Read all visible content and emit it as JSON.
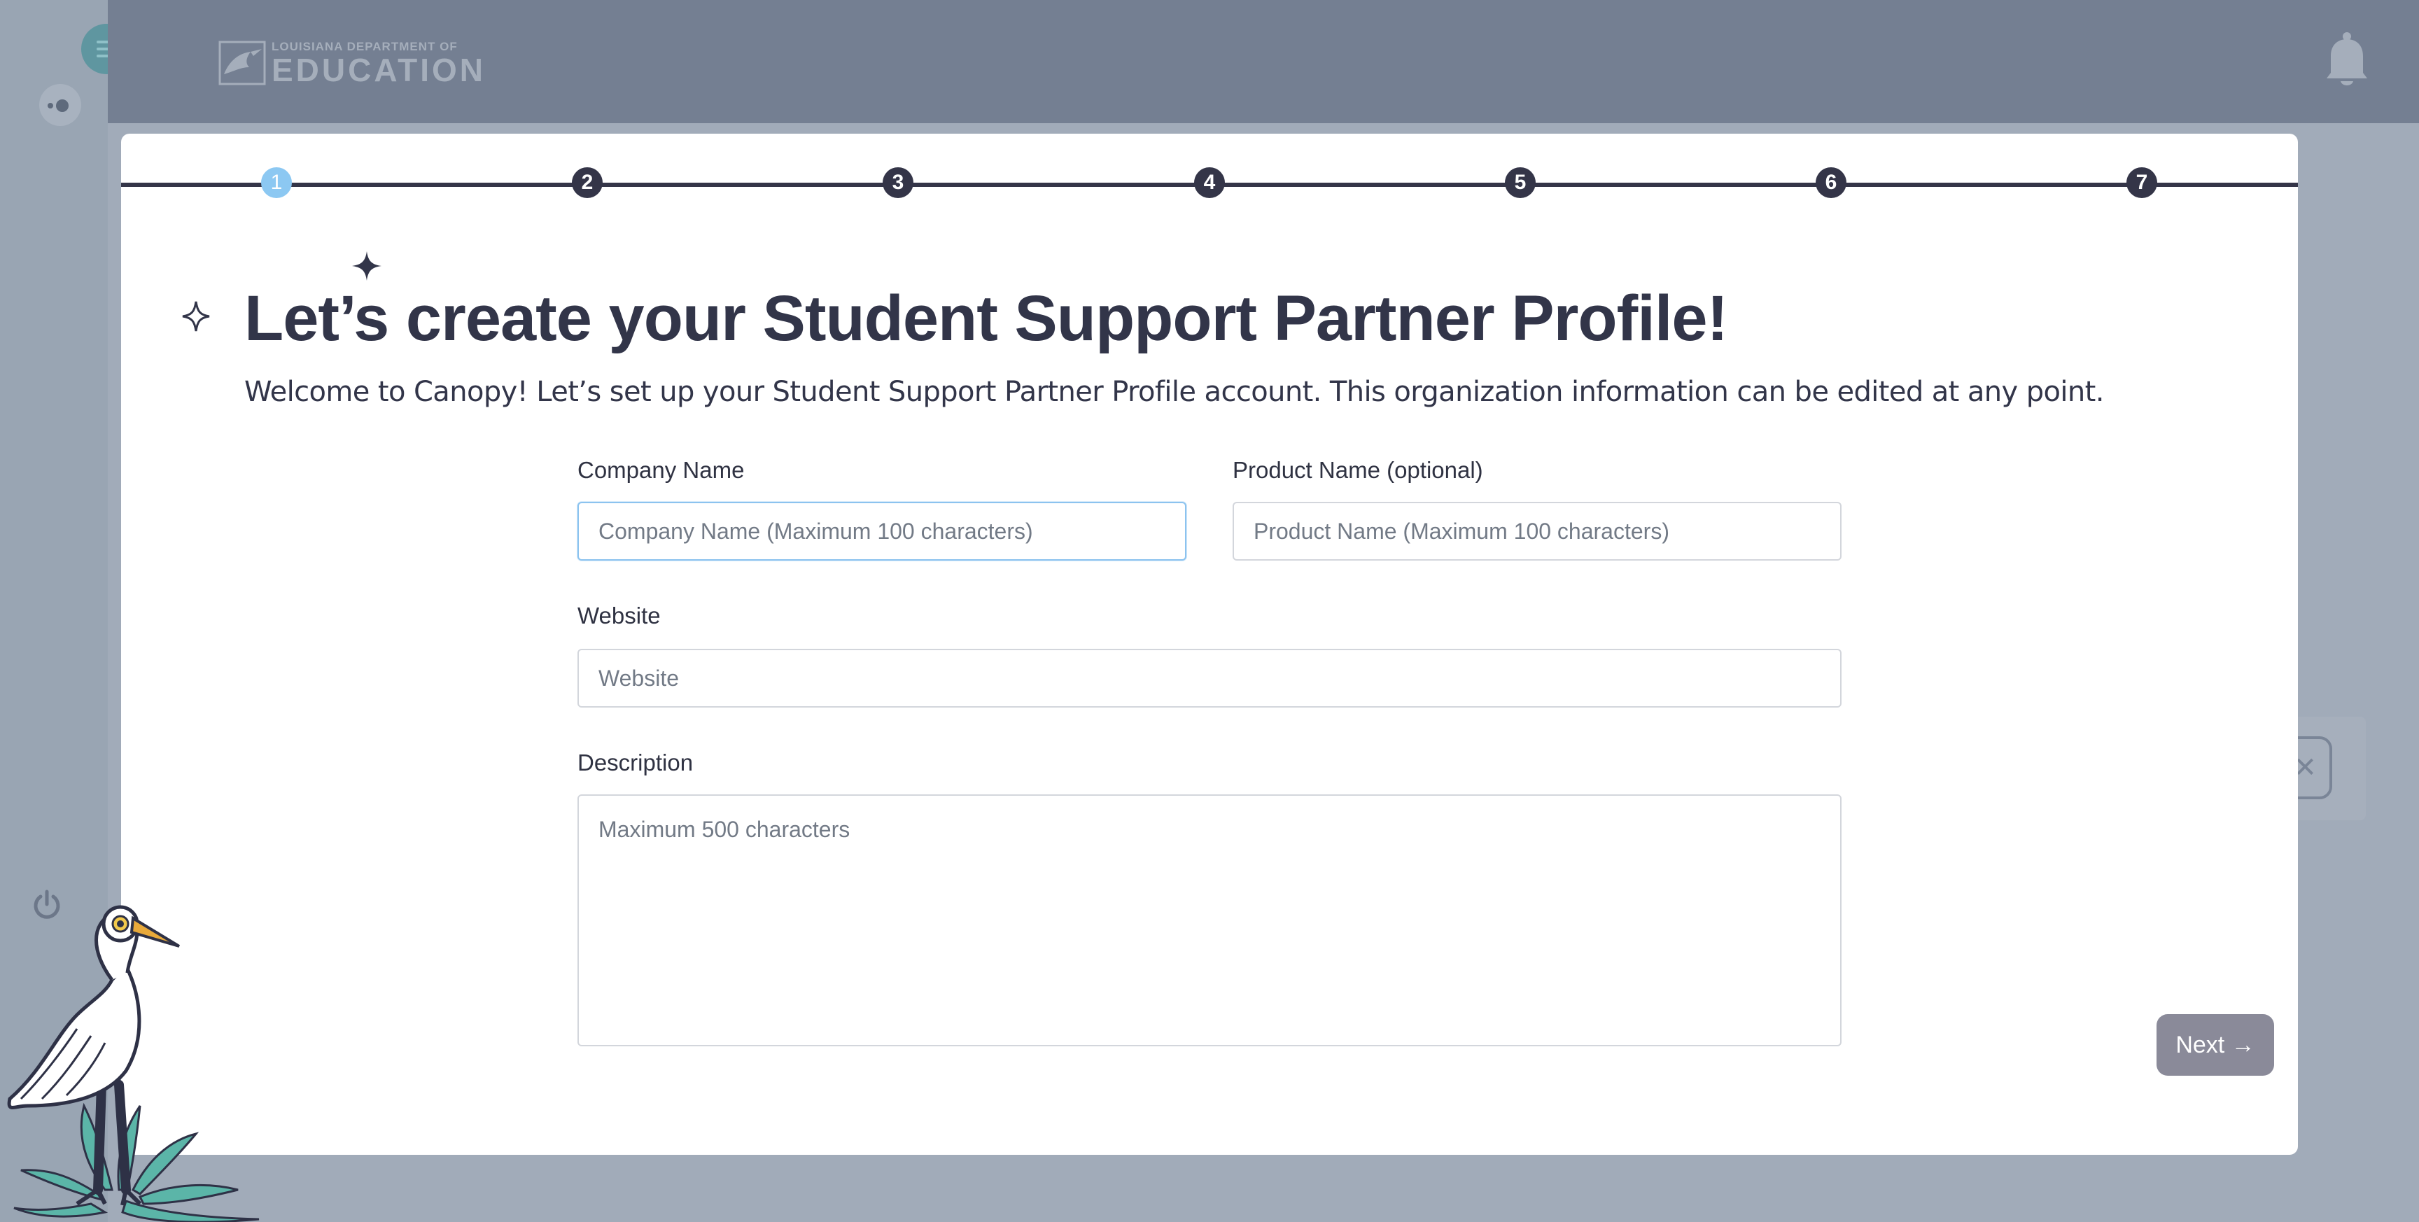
{
  "app": {
    "logo": {
      "line1": "LOUISIANA DEPARTMENT OF",
      "line2": "EDUCATION"
    }
  },
  "stepper": {
    "steps": [
      "1",
      "2",
      "3",
      "4",
      "5",
      "6",
      "7"
    ],
    "active_step": 1
  },
  "form": {
    "title": "Let’s create your Student Support Partner Profile!",
    "subtitle": "Welcome to Canopy! Let’s set up your Student Support Partner Profile account. This organization information can be edited at any point.",
    "company_name": {
      "label": "Company Name",
      "placeholder": "Company Name (Maximum 100 characters)",
      "value": ""
    },
    "product_name": {
      "label": "Product Name (optional)",
      "placeholder": "Product Name (Maximum 100 characters)",
      "value": ""
    },
    "website": {
      "label": "Website",
      "placeholder": "Website",
      "value": ""
    },
    "description": {
      "label": "Description",
      "placeholder": "Maximum 500 characters",
      "value": ""
    },
    "next_label": "Next →"
  },
  "icons": {
    "menu": "hamburger-menu-icon",
    "toggle": "sidebar-toggle-icon",
    "power": "power-icon",
    "notifications": "bell-icon",
    "decoration": [
      "sparkle-filled-icon",
      "sparkle-outline-icon",
      "egret-illustration"
    ]
  },
  "colors": {
    "modal_background": "#ffffff",
    "text_dark": "#323549",
    "active_step": "#8cc8f2",
    "step": "#343548",
    "next_button": "#8a8a99",
    "overlay": "#a1abb9"
  }
}
